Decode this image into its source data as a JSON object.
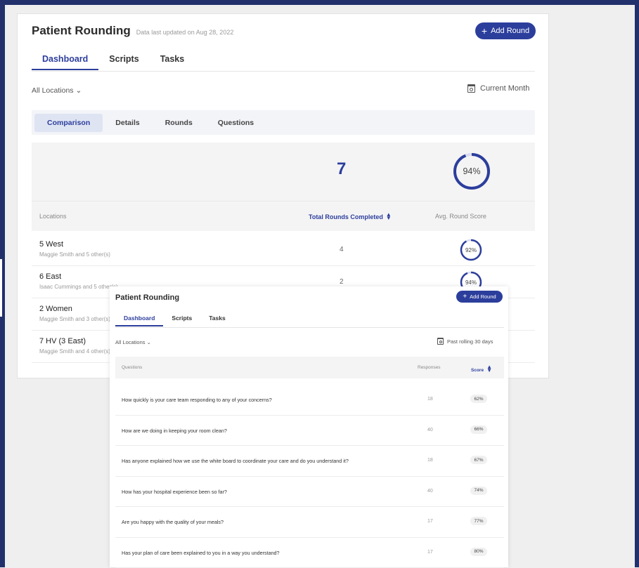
{
  "colors": {
    "accent": "#2c3e9c",
    "frame": "#22306b",
    "ring_track": "#d9dcef"
  },
  "main": {
    "title": "Patient Rounding",
    "updated": "Data last updated on Aug 28, 2022",
    "add_round": "Add Round",
    "tabs": [
      {
        "label": "Dashboard"
      },
      {
        "label": "Scripts"
      },
      {
        "label": "Tasks"
      }
    ],
    "location_filter": "All Locations",
    "date_filter": "Current Month",
    "subtabs": [
      {
        "label": "Comparison"
      },
      {
        "label": "Details"
      },
      {
        "label": "Rounds"
      },
      {
        "label": "Questions"
      }
    ],
    "summary": {
      "total_rounds": "7",
      "avg_score": "94%",
      "avg_score_value": 94
    },
    "table": {
      "headers": {
        "locations": "Locations",
        "total_rounds": "Total Rounds Completed",
        "avg_score": "Avg. Round Score"
      },
      "rows": [
        {
          "location": "5 West",
          "staff": "Maggie Smith and 5 other(s)",
          "rounds": "4",
          "score": "92%",
          "score_value": 92
        },
        {
          "location": "6 East",
          "staff": "Isaac Cummings and 5 other(s)",
          "rounds": "2",
          "score": "94%",
          "score_value": 94
        },
        {
          "location": "2 Women",
          "staff": "Maggie Smith and 3 other(s)",
          "rounds": "",
          "score": "",
          "score_value": null
        },
        {
          "location": "7 HV (3 East)",
          "staff": "Maggie Smith and 4 other(s)",
          "rounds": "",
          "score": "",
          "score_value": null
        }
      ]
    }
  },
  "overlay": {
    "title": "Patient Rounding",
    "add_round": "Add Round",
    "tabs": [
      {
        "label": "Dashboard"
      },
      {
        "label": "Scripts"
      },
      {
        "label": "Tasks"
      }
    ],
    "location_filter": "All Locations",
    "date_filter": "Past rolling 30 days",
    "table": {
      "headers": {
        "questions": "Questions",
        "responses": "Responses",
        "score": "Score"
      },
      "rows": [
        {
          "question": "How quickly is your care team responding to any of your concerns?",
          "responses": "18",
          "score": "62%"
        },
        {
          "question": "How are we doing in keeping your room clean?",
          "responses": "40",
          "score": "66%"
        },
        {
          "question": "Has anyone explained how we use the white board to coordinate your care and do you understand it?",
          "responses": "18",
          "score": "67%"
        },
        {
          "question": "How has your hospital experience been so far?",
          "responses": "40",
          "score": "74%"
        },
        {
          "question": "Are you happy with the quality of your meals?",
          "responses": "17",
          "score": "77%"
        },
        {
          "question": "Has your plan of care been explained to you in a way you understand?",
          "responses": "17",
          "score": "80%"
        }
      ]
    }
  }
}
